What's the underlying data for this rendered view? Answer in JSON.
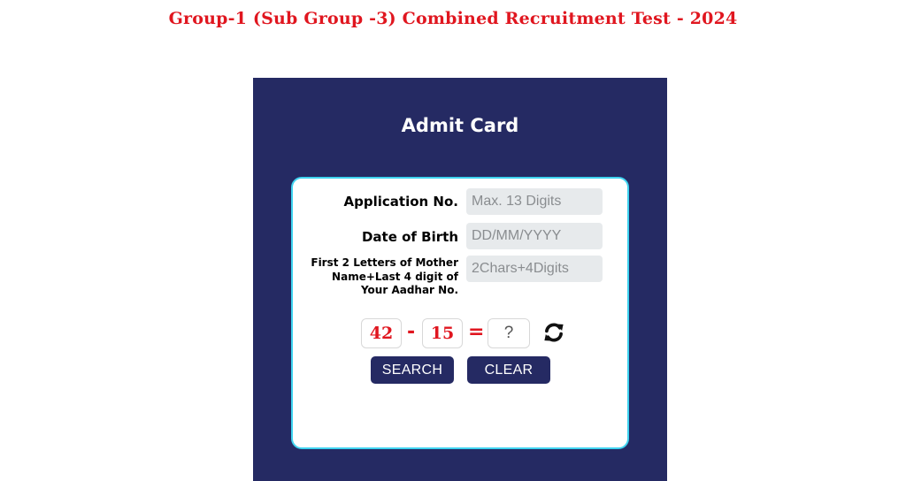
{
  "page": {
    "title": "Group-1 (Sub Group -3) Combined Recruitment Test - 2024"
  },
  "admit_card": {
    "heading": "Admit Card",
    "application_no": {
      "label": "Application No.",
      "placeholder": "Max. 13 Digits"
    },
    "date_of_birth": {
      "label": "Date of Birth",
      "placeholder": "DD/MM/YYYY"
    },
    "security_code": {
      "label": "First 2 Letters of Mother Name+Last 4 digit of Your Aadhar No.",
      "placeholder": "2Chars+4Digits"
    },
    "captcha": {
      "operand1": "42",
      "operator": "-",
      "operand2": "15",
      "equals": "=",
      "answer_placeholder": "?",
      "refresh_icon": "refresh-icon"
    },
    "buttons": {
      "search": "SEARCH",
      "clear": "CLEAR"
    },
    "colors": {
      "panel_bg": "#252a63",
      "title_red": "#e0161f",
      "box_border": "#3fd3f0",
      "field_bg": "#e7eaec"
    }
  }
}
